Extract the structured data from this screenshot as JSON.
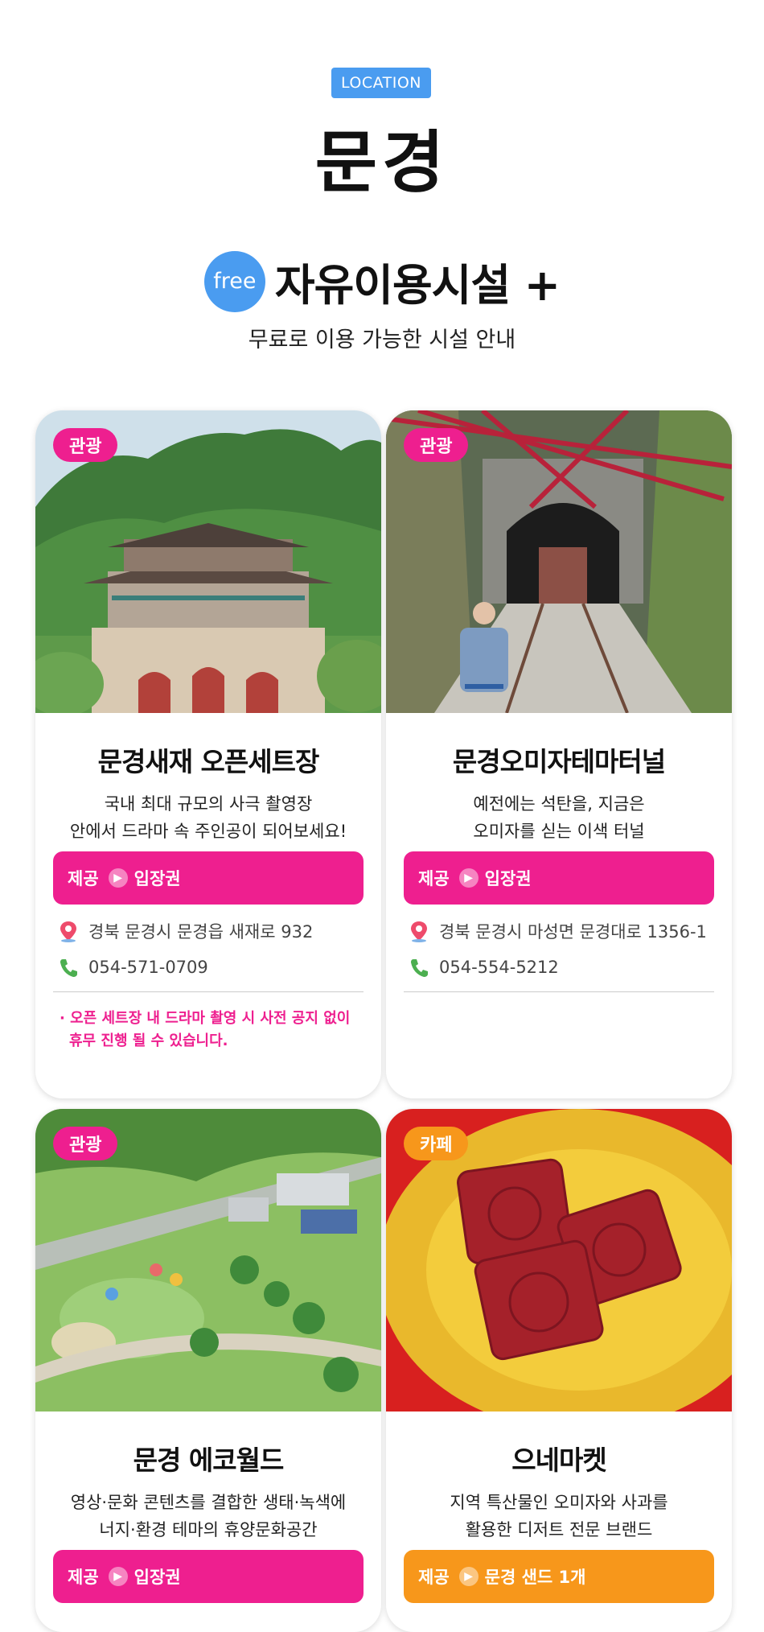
{
  "header": {
    "location_badge": "LOCATION",
    "city": "문경"
  },
  "section": {
    "free_badge": "free",
    "title": "자유이용시설 +",
    "subtitle": "무료로 이용 가능한 시설 안내"
  },
  "cards": [
    {
      "category": "관광",
      "title": "문경새재 오픈세트장",
      "desc_line1": "국내 최대 규모의 사극 촬영장",
      "desc_line2": "안에서 드라마 속 주인공이 되어보세요!",
      "provide_label": "제공",
      "provide_value": "입장권",
      "address": "경북 문경시 문경읍 새재로 932",
      "phone": "054-571-0709",
      "notice_line1": "· 오픈 세트장 내 드라마 촬영 시 사전 공지 없이",
      "notice_line2": "휴무 진행 될 수 있습니다."
    },
    {
      "category": "관광",
      "title": "문경오미자테마터널",
      "desc_line1": "예전에는 석탄을, 지금은",
      "desc_line2": "오미자를 싣는 이색 터널",
      "provide_label": "제공",
      "provide_value": "입장권",
      "address": "경북 문경시 마성면 문경대로 1356-1",
      "phone": "054-554-5212"
    },
    {
      "category": "관광",
      "title": "문경 에코월드",
      "desc_line1": "영상·문화 콘텐츠를 결합한 생태·녹색에",
      "desc_line2": "너지·환경 테마의 휴양문화공간",
      "provide_label": "제공",
      "provide_value": "입장권"
    },
    {
      "category": "카페",
      "title": "으네마켓",
      "desc_line1": "지역 특산물인 오미자와 사과를",
      "desc_line2": "활용한 디저트 전문 브랜드",
      "provide_label": "제공",
      "provide_value": "문경 샌드 1개"
    }
  ],
  "colors": {
    "accent_blue": "#4a9cf0",
    "accent_pink": "#ee1f8f",
    "accent_orange": "#f7971b"
  }
}
